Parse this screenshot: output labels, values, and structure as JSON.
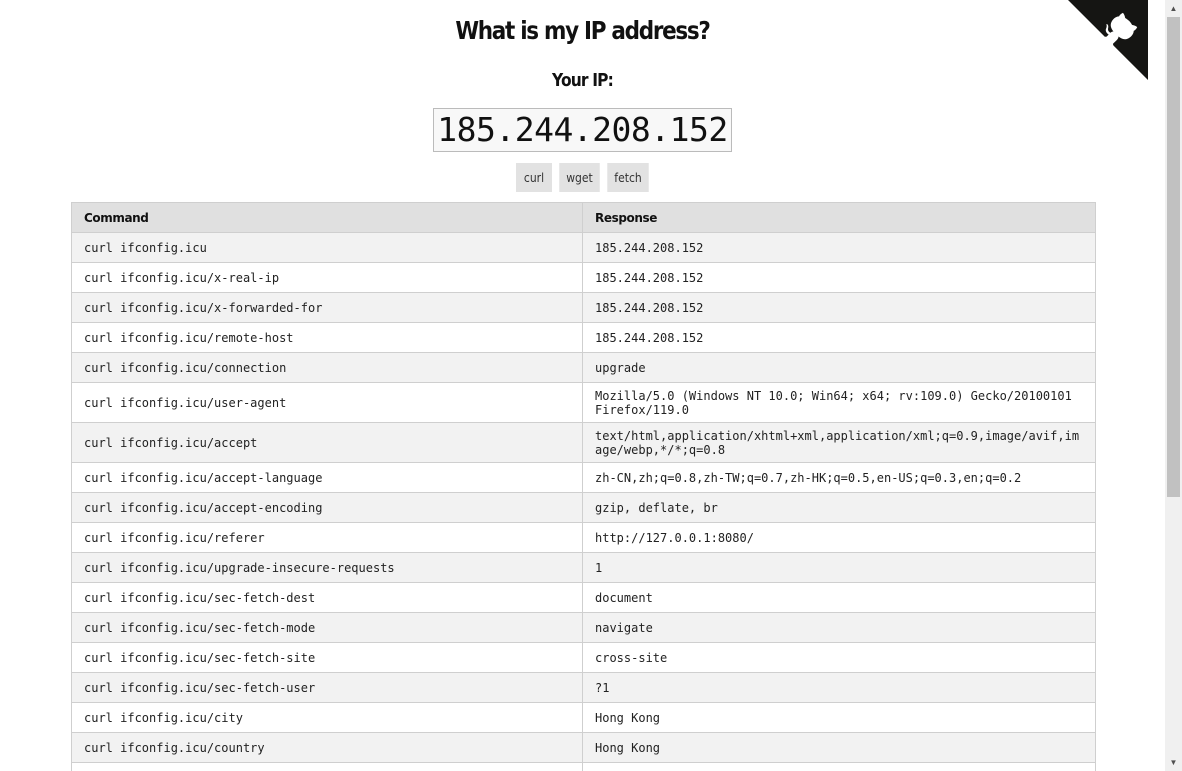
{
  "header": {
    "title": "What is my IP address?",
    "your_ip_label": "Your IP:",
    "ip": "185.244.208.152"
  },
  "buttons": {
    "curl": "curl",
    "wget": "wget",
    "fetch": "fetch"
  },
  "table": {
    "headers": [
      "Command",
      "Response"
    ],
    "rows": [
      {
        "command": "curl ifconfig.icu",
        "response": "185.244.208.152"
      },
      {
        "command": "curl ifconfig.icu/x-real-ip",
        "response": "185.244.208.152"
      },
      {
        "command": "curl ifconfig.icu/x-forwarded-for",
        "response": "185.244.208.152"
      },
      {
        "command": "curl ifconfig.icu/remote-host",
        "response": "185.244.208.152"
      },
      {
        "command": "curl ifconfig.icu/connection",
        "response": "upgrade"
      },
      {
        "command": "curl ifconfig.icu/user-agent",
        "response": "Mozilla/5.0 (Windows NT 10.0; Win64; x64; rv:109.0) Gecko/20100101 Firefox/119.0"
      },
      {
        "command": "curl ifconfig.icu/accept",
        "response": "text/html,application/xhtml+xml,application/xml;q=0.9,image/avif,image/webp,*/*;q=0.8"
      },
      {
        "command": "curl ifconfig.icu/accept-language",
        "response": "zh-CN,zh;q=0.8,zh-TW;q=0.7,zh-HK;q=0.5,en-US;q=0.3,en;q=0.2"
      },
      {
        "command": "curl ifconfig.icu/accept-encoding",
        "response": "gzip, deflate, br"
      },
      {
        "command": "curl ifconfig.icu/referer",
        "response": "http://127.0.0.1:8080/"
      },
      {
        "command": "curl ifconfig.icu/upgrade-insecure-requests",
        "response": "1"
      },
      {
        "command": "curl ifconfig.icu/sec-fetch-dest",
        "response": "document"
      },
      {
        "command": "curl ifconfig.icu/sec-fetch-mode",
        "response": "navigate"
      },
      {
        "command": "curl ifconfig.icu/sec-fetch-site",
        "response": "cross-site"
      },
      {
        "command": "curl ifconfig.icu/sec-fetch-user",
        "response": "?1"
      },
      {
        "command": "curl ifconfig.icu/city",
        "response": "Hong Kong"
      },
      {
        "command": "curl ifconfig.icu/country",
        "response": "Hong Kong"
      }
    ]
  },
  "icons": {
    "corner": "github-octocat-icon",
    "scroll_up": "scroll-up-arrow-icon",
    "scroll_down": "scroll-down-arrow-icon"
  },
  "colors": {
    "table_header": "#e0e0e0",
    "row_alt": "#f2f2f2",
    "button": "#e2e2e2",
    "corner": "#151513"
  }
}
